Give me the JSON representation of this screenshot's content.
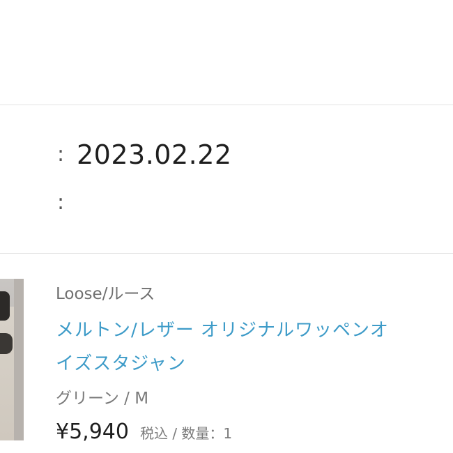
{
  "order": {
    "date_colon": ":",
    "date": "2023.02.22",
    "second_colon": ":"
  },
  "item": {
    "brand": "Loose/ルース",
    "title_line1": "メルトン/レザー オリジナルワッペンオ",
    "title_line2": "イズスタジャン",
    "variant": "グリーン / M",
    "price": "¥5,940",
    "price_meta": "税込 / 数量：1"
  },
  "colors": {
    "link": "#3d9bc8",
    "text": "#1e1e1e",
    "muted": "#7a7a7a",
    "divider": "#e2e2e2"
  }
}
